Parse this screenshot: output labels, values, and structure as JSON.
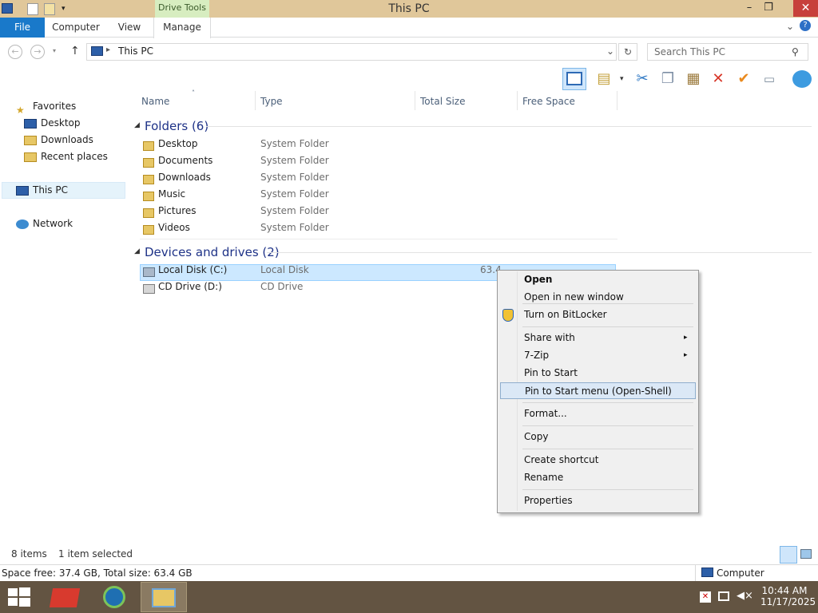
{
  "window": {
    "title": "This PC",
    "context_tab": "Drive Tools",
    "minimize": "–",
    "restore": "❐",
    "close": "✕"
  },
  "ribbon": {
    "file": "File",
    "computer": "Computer",
    "view": "View",
    "manage": "Manage",
    "collapse": "⌄",
    "help": "?"
  },
  "nav": {
    "back": "←",
    "forward": "→",
    "up": "↑",
    "path_root": "▸",
    "location": "This PC",
    "dropdown": "⌄",
    "refresh": "↻",
    "search_placeholder": "Search This PC",
    "search_icon": "⚲"
  },
  "sidebar": {
    "favorites": "Favorites",
    "fav_items": [
      "Desktop",
      "Downloads",
      "Recent places"
    ],
    "this_pc": "This PC",
    "network": "Network"
  },
  "columns": {
    "name": "Name",
    "type": "Type",
    "total": "Total Size",
    "free": "Free Space"
  },
  "groups": {
    "folders": "Folders (6)",
    "drives": "Devices and drives (2)"
  },
  "folders": [
    {
      "name": "Desktop",
      "type": "System Folder"
    },
    {
      "name": "Documents",
      "type": "System Folder"
    },
    {
      "name": "Downloads",
      "type": "System Folder"
    },
    {
      "name": "Music",
      "type": "System Folder"
    },
    {
      "name": "Pictures",
      "type": "System Folder"
    },
    {
      "name": "Videos",
      "type": "System Folder"
    }
  ],
  "drives": [
    {
      "name": "Local Disk (C:)",
      "type": "Local Disk",
      "total": "63.4"
    },
    {
      "name": "CD Drive (D:)",
      "type": "CD Drive",
      "total": ""
    }
  ],
  "context_menu": {
    "open": "Open",
    "open_new": "Open in new window",
    "bitlocker": "Turn on BitLocker",
    "share_with": "Share with",
    "sevenzip": "7-Zip",
    "pin_start": "Pin to Start",
    "pin_openshell": "Pin to Start menu (Open-Shell)",
    "format": "Format...",
    "copy": "Copy",
    "create_shortcut": "Create shortcut",
    "rename": "Rename",
    "properties": "Properties",
    "submenu_arrow": "▸"
  },
  "status": {
    "items": "8 items",
    "selected": "1 item selected",
    "space": "Space free: 37.4 GB, Total size: 63.4 GB",
    "computer": "Computer"
  },
  "taskbar": {
    "time": "10:44 AM",
    "date": "11/17/2025"
  },
  "colors": {
    "titlebar": "#e0c79a",
    "file_tab": "#1979ca",
    "close": "#c7403b",
    "selection": "#cce8ff",
    "taskbar": "#635442",
    "group": "#1e3287"
  }
}
